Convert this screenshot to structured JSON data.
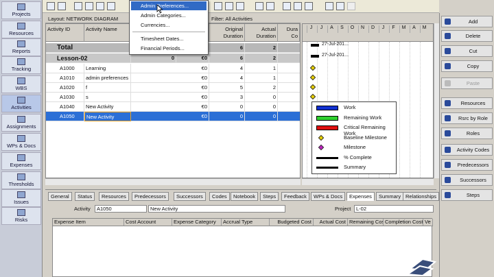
{
  "left_nav": [
    {
      "label": "Projects",
      "sel": false
    },
    {
      "label": "Resources",
      "sel": false
    },
    {
      "label": "Reports",
      "sel": false
    },
    {
      "label": "Tracking",
      "sel": false
    },
    {
      "label": "WBS",
      "sel": false
    },
    {
      "label": "Activities",
      "sel": true
    },
    {
      "label": "Assignments",
      "sel": false
    },
    {
      "label": "WPs & Docs",
      "sel": false
    },
    {
      "label": "Expenses",
      "sel": false
    },
    {
      "label": "Thresholds",
      "sel": false
    },
    {
      "label": "Issues",
      "sel": false
    },
    {
      "label": "Risks",
      "sel": false
    }
  ],
  "layout_bar": {
    "layout": "Layout: NETWORK DIAGRAM",
    "filter": "Filter: All Activities"
  },
  "grid": {
    "headers": [
      "Activity ID",
      "Activity Name",
      "",
      "",
      "",
      "",
      "",
      "Original Duration",
      "Actual Duration",
      "Dura Co"
    ],
    "total": {
      "label": "Total",
      "orig": "6",
      "actual": "2"
    },
    "group": {
      "label": "Lesson-02",
      "col3": "0",
      "col5": "€0",
      "orig": "6",
      "actual": "2"
    },
    "rows": [
      {
        "id": "A1000",
        "name": "Learning",
        "cost": "€0",
        "orig": "4",
        "actual": "1",
        "sel": false
      },
      {
        "id": "A1010",
        "name": "admin preferences",
        "cost": "€0",
        "orig": "4",
        "actual": "1",
        "sel": false
      },
      {
        "id": "A1020",
        "name": "f",
        "cost": "€0",
        "orig": "5",
        "actual": "2",
        "sel": false
      },
      {
        "id": "A1030",
        "name": "s",
        "cost": "€0",
        "orig": "3",
        "actual": "0",
        "sel": false
      },
      {
        "id": "A1040",
        "name": "New Activity",
        "cost": "€0",
        "orig": "0",
        "actual": "0",
        "sel": false
      },
      {
        "id": "A1050",
        "name": "New Activity",
        "cost": "€0",
        "orig": "0",
        "actual": "0",
        "sel": true
      }
    ]
  },
  "gantt": {
    "months": [
      "J",
      "J",
      "A",
      "S",
      "O",
      "N",
      "D",
      "J",
      "F",
      "M",
      "A",
      "M"
    ],
    "date_labels": [
      "27-Jul-201...",
      "27-Jul-201..."
    ]
  },
  "legend": [
    {
      "label": "Work",
      "color": "#1030d0",
      "shape": "bar"
    },
    {
      "label": "Remaining Work",
      "color": "#30d030",
      "shape": "bar"
    },
    {
      "label": "Critical Remaining Work",
      "color": "#e01010",
      "shape": "bar"
    },
    {
      "label": "Baseline Milestone",
      "color": "#e8d000",
      "shape": "diamond"
    },
    {
      "label": "Milestone",
      "color": "#c020c0",
      "shape": "diamond"
    },
    {
      "label": "% Complete",
      "color": "#000000",
      "shape": "line"
    },
    {
      "label": "Summary",
      "color": "#000000",
      "shape": "summary"
    }
  ],
  "menu": {
    "items": [
      "Admin Preferences...",
      "Admin Categories...",
      "Currencies...",
      "Timesheet Dates...",
      "Financial Periods..."
    ],
    "highlight": 0
  },
  "right_panel": [
    {
      "label": "Add",
      "icon": "add-icon",
      "dis": false
    },
    {
      "label": "Delete",
      "icon": "delete-icon",
      "dis": false
    },
    {
      "label": "Cut",
      "icon": "cut-icon",
      "dis": false
    },
    {
      "label": "Copy",
      "icon": "copy-icon",
      "dis": false
    },
    {
      "label": "Paste",
      "icon": "paste-icon",
      "dis": true
    },
    {
      "label": "Resources",
      "icon": "resources-icon",
      "dis": false
    },
    {
      "label": "Rsrc by Role",
      "icon": "rsrc-by-role-icon",
      "dis": false
    },
    {
      "label": "Roles",
      "icon": "roles-icon",
      "dis": false
    },
    {
      "label": "Activity Codes",
      "icon": "activity-codes-icon",
      "dis": false
    },
    {
      "label": "Predecessors",
      "icon": "predecessors-icon",
      "dis": false
    },
    {
      "label": "Successors",
      "icon": "successors-icon",
      "dis": false
    },
    {
      "label": "Steps",
      "icon": "steps-icon",
      "dis": false
    }
  ],
  "detail": {
    "tabs": [
      "General",
      "Status",
      "Resources",
      "Predecessors",
      "Successors",
      "Codes",
      "Notebook",
      "Steps",
      "Feedback",
      "WPs & Docs",
      "Expenses",
      "Summary",
      "Relationships"
    ],
    "active_tab": "Expenses",
    "activity_label": "Activity",
    "activity_id": "A1050",
    "activity_name": "New Activity",
    "project_label": "Project",
    "project_id": "L-02",
    "expense_headers": [
      "Expense Item",
      "Cost Account",
      "Expense Category",
      "Accrual Type",
      "Budgeted Cost",
      "Actual Cost",
      "Remaining Cost",
      "Completion Cost",
      "Ve"
    ]
  }
}
